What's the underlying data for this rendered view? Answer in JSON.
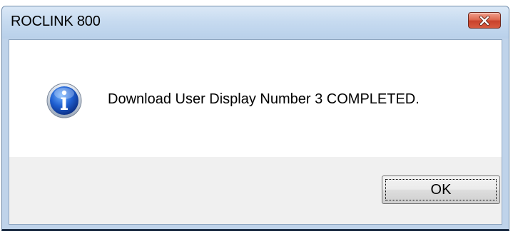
{
  "window": {
    "title": "ROCLINK 800",
    "close_icon": "close-icon",
    "close_color": "#c9422b"
  },
  "dialog": {
    "icon": "info-icon",
    "message": "Download User Display Number 3 COMPLETED.",
    "ok_label": "OK"
  }
}
